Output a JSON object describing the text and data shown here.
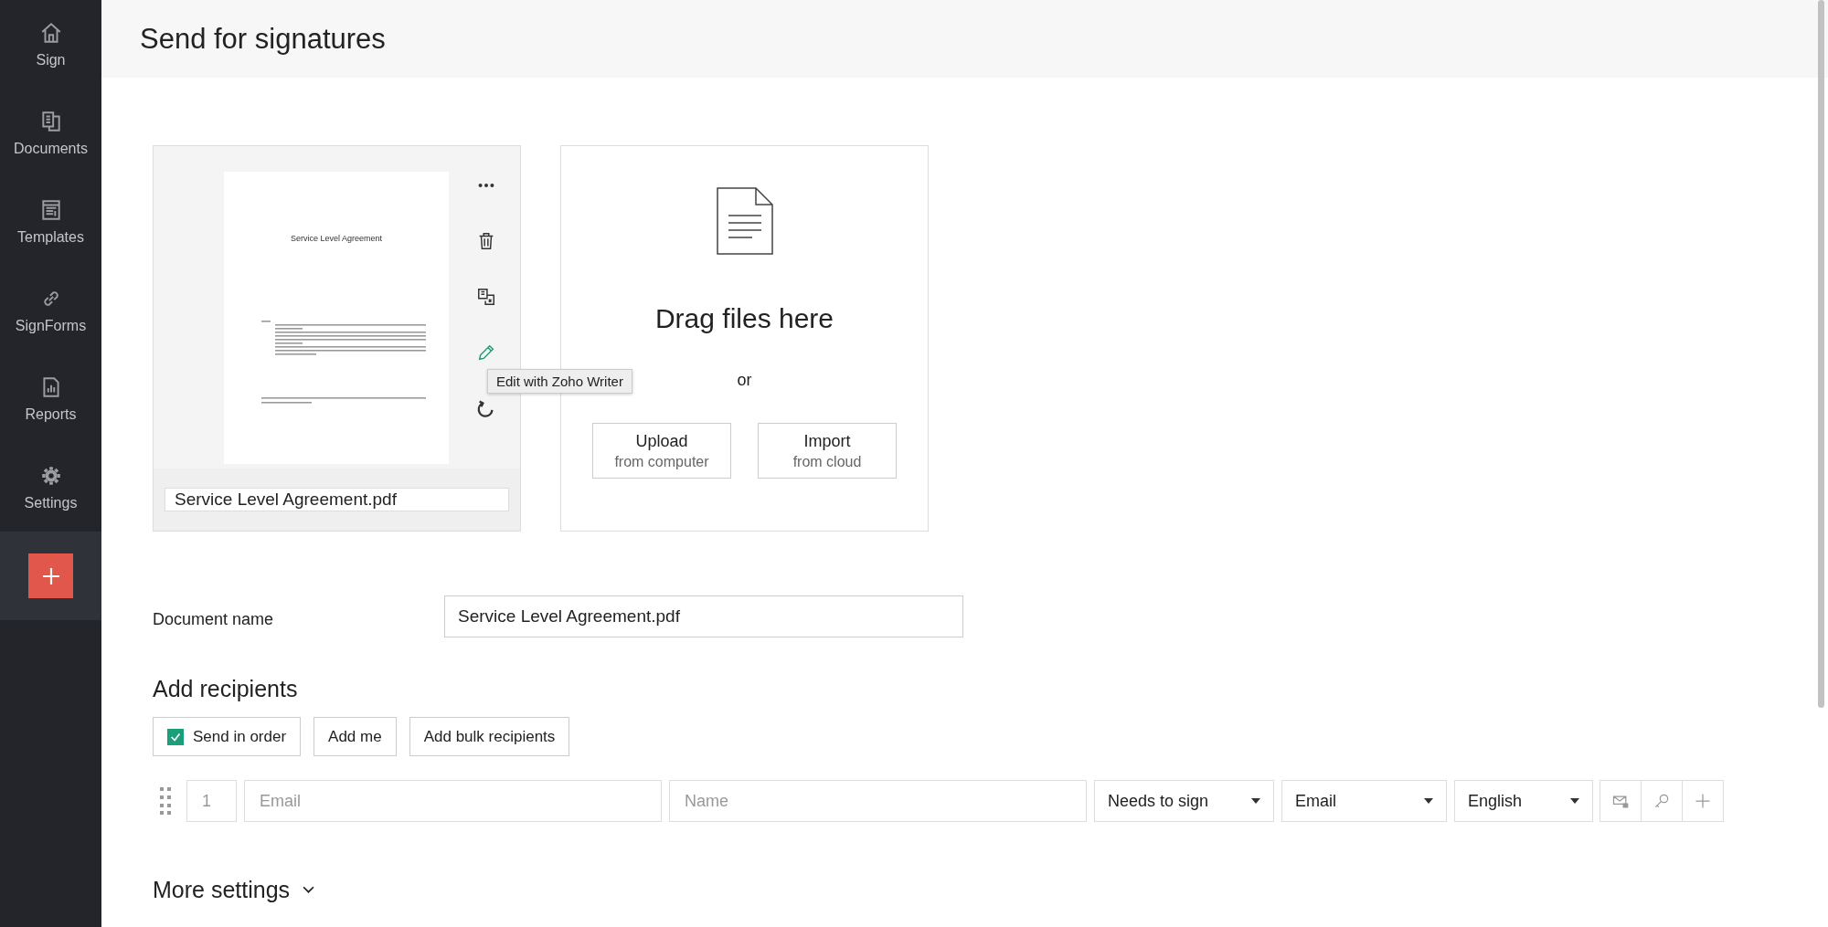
{
  "sidebar": {
    "items": [
      {
        "label": "Sign",
        "kind": "home"
      },
      {
        "label": "Documents",
        "kind": "documents"
      },
      {
        "label": "Templates",
        "kind": "templates"
      },
      {
        "label": "SignForms",
        "kind": "link"
      },
      {
        "label": "Reports",
        "kind": "reports"
      },
      {
        "label": "Settings",
        "kind": "settings"
      }
    ]
  },
  "header": {
    "title": "Send for signatures"
  },
  "document": {
    "preview_title": "Service Level Agreement",
    "file_name": "Service Level Agreement.pdf",
    "actions": [
      {
        "kind": "more",
        "hovered": false
      },
      {
        "kind": "delete",
        "hovered": false
      },
      {
        "kind": "replace",
        "hovered": false
      },
      {
        "kind": "edit",
        "hovered": true
      },
      {
        "kind": "rotate",
        "hovered": false
      }
    ],
    "tooltip": "Edit with Zoho Writer"
  },
  "upload": {
    "title": "Drag files here",
    "separator": "or",
    "buttons": [
      {
        "label": "Upload",
        "sublabel": "from computer"
      },
      {
        "label": "Import",
        "sublabel": "from cloud"
      }
    ]
  },
  "document_name": {
    "label": "Document name",
    "value": "Service Level Agreement.pdf"
  },
  "recipients": {
    "title": "Add recipients",
    "send_in_order": {
      "label": "Send in order",
      "checked": true
    },
    "buttons": [
      "Add me",
      "Add bulk recipients"
    ],
    "rows": [
      {
        "order": "1",
        "email_placeholder": "Email",
        "name_placeholder": "Name",
        "role": "Needs to sign",
        "delivery": "Email",
        "language": "English"
      }
    ]
  },
  "more_settings": {
    "label": "More settings",
    "expanded": false
  }
}
